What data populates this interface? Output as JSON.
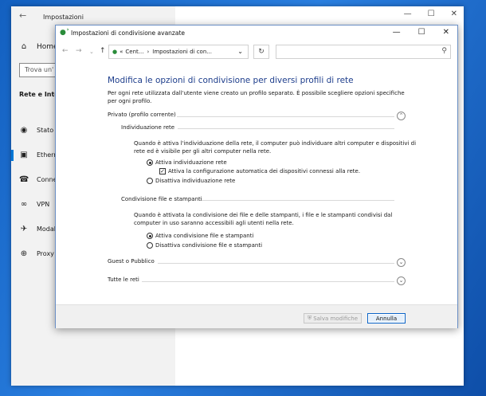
{
  "settings": {
    "title": "Impostazioni",
    "home_label": "Home",
    "search_placeholder": "Trova un'",
    "section_label": "Rete e Inte",
    "nav": [
      {
        "label": "Stato",
        "icon": "globe-stand-icon"
      },
      {
        "label": "Ethern",
        "icon": "ethernet-icon"
      },
      {
        "label": "Conne",
        "icon": "dialup-icon"
      },
      {
        "label": "VPN",
        "icon": "vpn-icon"
      },
      {
        "label": "Modal",
        "icon": "airplane-icon"
      },
      {
        "label": "Proxy",
        "icon": "globe-icon"
      }
    ]
  },
  "dialog": {
    "title": "Impostazioni di condivisione avanzate",
    "breadcrumb": {
      "root": "Cent...",
      "current": "Impostazioni di con..."
    },
    "heading": "Modifica le opzioni di condivisione per diversi profili di rete",
    "intro": "Per ogni rete utilizzata dall'utente viene creato un profilo separato. È possibile scegliere opzioni specifiche per ogni profilo.",
    "private": {
      "label": "Privato (profilo corrente)",
      "discovery": {
        "label": "Individuazione rete",
        "description": "Quando è attiva l'individuazione della rete, il computer può individuare altri computer e dispositivi di rete ed è visibile per gli altri computer nella rete.",
        "on_label": "Attiva individuazione rete",
        "auto_label": "Attiva la configurazione automatica dei dispositivi connessi alla rete.",
        "off_label": "Disattiva individuazione rete"
      },
      "sharing": {
        "label": "Condivisione file e stampanti",
        "description": "Quando è attivata la condivisione dei file e delle stampanti, i file e le stampanti condivisi dal computer in uso saranno accessibili agli utenti nella rete.",
        "on_label": "Attiva condivisione file e stampanti",
        "off_label": "Disattiva condivisione file e stampanti"
      }
    },
    "guest_label": "Guest o Pubblico",
    "all_label": "Tutte le reti",
    "save_label": "Salva modifiche",
    "cancel_label": "Annulla"
  },
  "colors": {
    "heading": "#1e3e8c",
    "accent": "#0078d7",
    "desktop": "#1b68c4"
  }
}
